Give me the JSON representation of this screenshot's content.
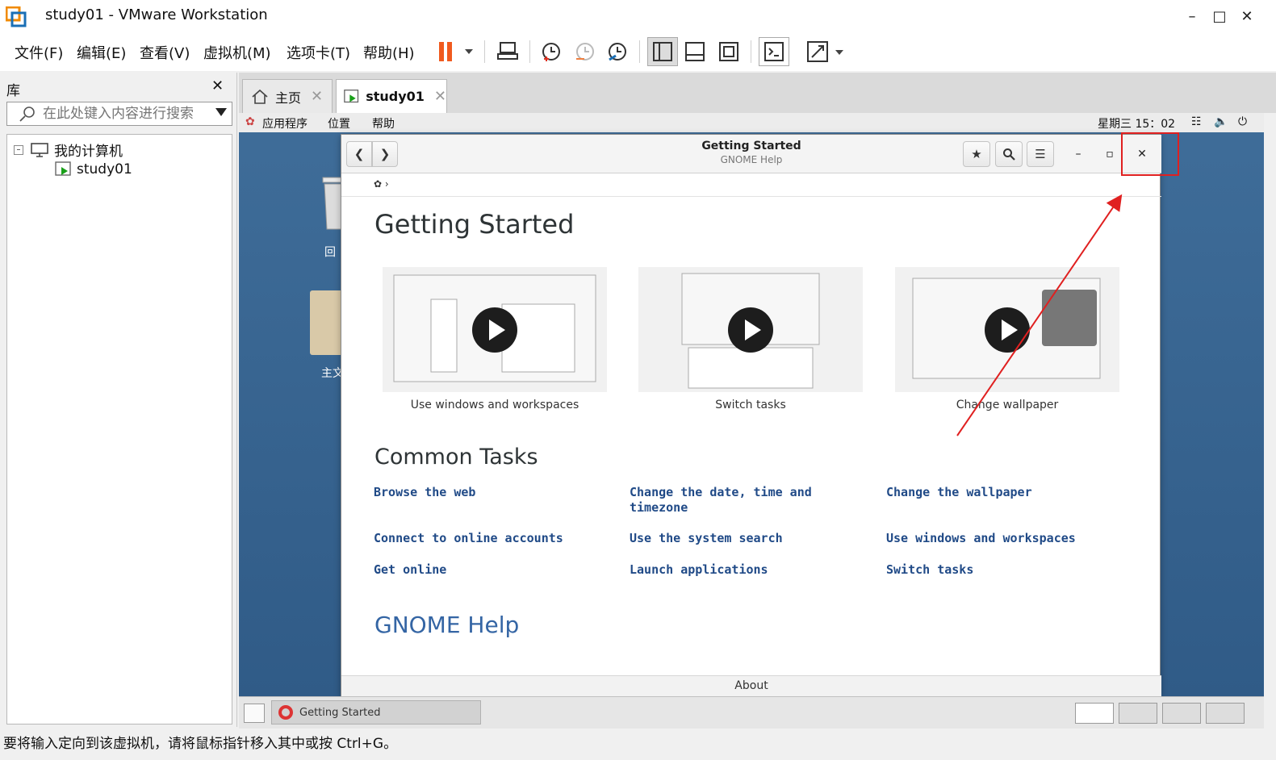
{
  "window": {
    "title": "study01 - VMware Workstation"
  },
  "menu": {
    "file": "文件(F)",
    "edit": "编辑(E)",
    "view": "查看(V)",
    "vm": "虚拟机(M)",
    "tabs": "选项卡(T)",
    "help": "帮助(H)"
  },
  "library": {
    "title": "库",
    "search_placeholder": "在此处键入内容进行搜索",
    "tree": {
      "root": "我的计算机",
      "child": "study01"
    }
  },
  "tabs": [
    {
      "label": "主页"
    },
    {
      "label": "study01"
    }
  ],
  "gnome_panel": {
    "apps": "应用程序",
    "places": "位置",
    "help": "帮助",
    "clock": "星期三 15：02"
  },
  "desktop": {
    "trash_label": "回",
    "home_label": "主文"
  },
  "help_window": {
    "title": "Getting Started",
    "subtitle": "GNOME Help",
    "heading": "Getting Started",
    "videos": [
      {
        "caption": "Use windows and workspaces"
      },
      {
        "caption": "Switch tasks"
      },
      {
        "caption": "Change wallpaper"
      }
    ],
    "common_tasks_heading": "Common Tasks",
    "links": [
      [
        "Browse the web",
        "Change the date, time and timezone",
        "Change the wallpaper"
      ],
      [
        "Connect to online accounts",
        "Use the system search",
        "Use windows and workspaces"
      ],
      [
        "Get online",
        "Launch applications",
        "Switch tasks"
      ]
    ],
    "footer_heading": "GNOME Help",
    "about": "About"
  },
  "taskbar": {
    "item": "Getting Started"
  },
  "status": {
    "text": "要将输入定向到该虚拟机，请将鼠标指针移入其中或按 Ctrl+G。"
  },
  "colors": {
    "accent_link": "#204a87",
    "annotation": "#e02020",
    "desktop": "#3f6d99"
  }
}
